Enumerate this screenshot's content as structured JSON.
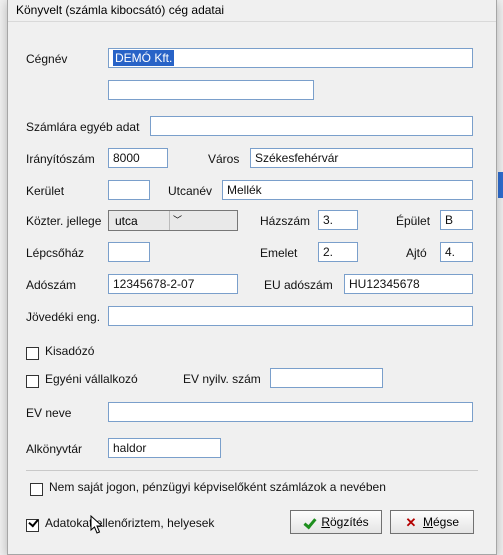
{
  "window": {
    "title": "Könyvelt (számla kibocsátó) cég adatai"
  },
  "labels": {
    "cegnev": "Cégnév",
    "szamlara": "Számlára egyéb adat",
    "iranyitoszam": "Irányítószám",
    "varos": "Város",
    "kerulet": "Kerület",
    "utcanev": "Utcanév",
    "kozter": "Közter. jellege",
    "hazszam": "Házszám",
    "epulet": "Épület",
    "lepcsohaz": "Lépcsőház",
    "emelet": "Emelet",
    "ajto": "Ajtó",
    "adoszam": "Adószám",
    "eu_adoszam": "EU adószám",
    "jovedeki": "Jövedéki eng.",
    "kisadozo": "Kisadózó",
    "egyeni": "Egyéni vállalkozó",
    "ev_nyilv": "EV nyilv. szám",
    "ev_neve": "EV neve",
    "alkonyvtar": "Alkönyvtár",
    "nem_sajat": "Nem saját jogon, pénzügyi képviselőként számlázok a nevében",
    "ellenoriztem": "Adatokat ellenőriztem, helyesek"
  },
  "values": {
    "cegnev": "DEMÓ Kft.",
    "cegnev2": "",
    "szamlara": "",
    "iranyitoszam": "8000",
    "varos": "Székesfehérvár",
    "kerulet": "",
    "utcanev": "Mellék",
    "kozter": "utca",
    "hazszam": "3.",
    "epulet": "B",
    "lepcsohaz": "",
    "emelet": "2.",
    "ajto": "4.",
    "adoszam": "12345678-2-07",
    "eu_adoszam": "HU12345678",
    "jovedeki": "",
    "ev_nyilv": "",
    "ev_neve": "",
    "alkonyvtar": "haldor"
  },
  "checks": {
    "kisadozo": false,
    "egyeni": false,
    "nem_sajat": false,
    "ellenoriztem": true
  },
  "buttons": {
    "rogzites_prefix": "R",
    "rogzites_rest": "ögzítés",
    "megse_prefix": "M",
    "megse_rest": "égse"
  }
}
